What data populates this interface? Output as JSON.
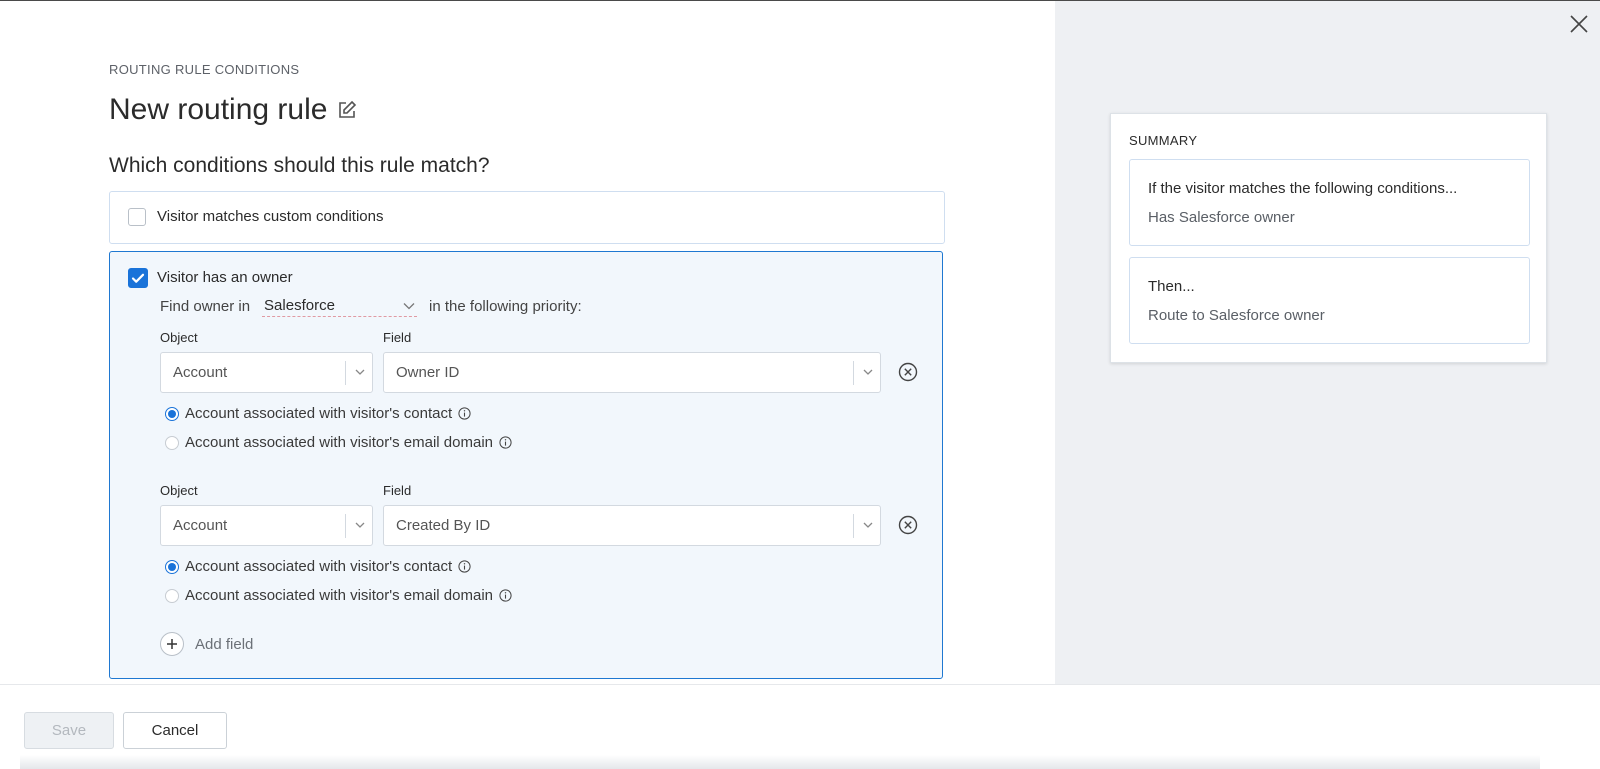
{
  "header": {
    "eyebrow": "ROUTING RULE CONDITIONS",
    "title": "New routing rule",
    "question": "Which conditions should this rule match?"
  },
  "conditions": {
    "custom": {
      "label": "Visitor matches custom conditions",
      "checked": false
    },
    "owner": {
      "label": "Visitor has an owner",
      "checked": true,
      "find_prefix": "Find owner in",
      "source": "Salesforce",
      "find_suffix": "in the following priority:",
      "object_label": "Object",
      "field_label": "Field",
      "rows": [
        {
          "object": "Account",
          "field": "Owner ID",
          "options": [
            {
              "label": "Account associated with visitor's contact",
              "selected": true
            },
            {
              "label": "Account associated with visitor's email domain",
              "selected": false
            }
          ]
        },
        {
          "object": "Account",
          "field": "Created By ID",
          "options": [
            {
              "label": "Account associated with visitor's contact",
              "selected": true
            },
            {
              "label": "Account associated with visitor's email domain",
              "selected": false
            }
          ]
        }
      ],
      "add_field": "Add field"
    }
  },
  "summary": {
    "heading": "SUMMARY",
    "if_title": "If the visitor matches the following conditions...",
    "if_detail": "Has Salesforce owner",
    "then_title": "Then...",
    "then_detail": "Route to Salesforce owner"
  },
  "footer": {
    "save": "Save",
    "cancel": "Cancel"
  },
  "colors": {
    "accent": "#1a73d9",
    "side_bg": "#eef0f3",
    "card_bg": "#f2f7fc"
  }
}
